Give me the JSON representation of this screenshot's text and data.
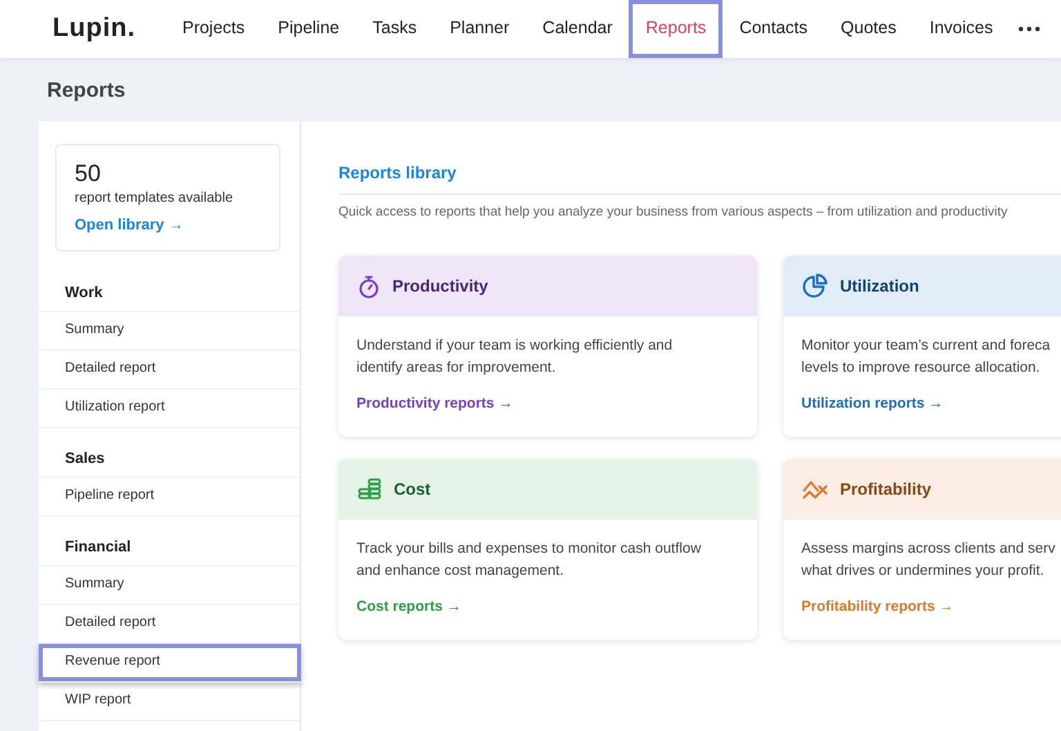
{
  "logo": "Lupin.",
  "nav": [
    {
      "label": "Projects",
      "selected": false,
      "highlighted": false
    },
    {
      "label": "Pipeline",
      "selected": false,
      "highlighted": false
    },
    {
      "label": "Tasks",
      "selected": false,
      "highlighted": false
    },
    {
      "label": "Planner",
      "selected": false,
      "highlighted": false
    },
    {
      "label": "Calendar",
      "selected": false,
      "highlighted": false
    },
    {
      "label": "Reports",
      "selected": true,
      "highlighted": true
    },
    {
      "label": "Contacts",
      "selected": false,
      "highlighted": false
    },
    {
      "label": "Quotes",
      "selected": false,
      "highlighted": false
    },
    {
      "label": "Invoices",
      "selected": false,
      "highlighted": false
    }
  ],
  "page_title": "Reports",
  "templates_card": {
    "count": "50",
    "caption": "report templates available",
    "link": "Open library →"
  },
  "sidebar": [
    {
      "heading": "Work",
      "items": [
        {
          "label": "Summary",
          "highlighted": false
        },
        {
          "label": "Detailed report",
          "highlighted": false
        },
        {
          "label": "Utilization report",
          "highlighted": false
        }
      ]
    },
    {
      "heading": "Sales",
      "items": [
        {
          "label": "Pipeline report",
          "highlighted": false
        }
      ]
    },
    {
      "heading": "Financial",
      "items": [
        {
          "label": "Summary",
          "highlighted": false
        },
        {
          "label": "Detailed report",
          "highlighted": false
        },
        {
          "label": "Revenue report",
          "highlighted": true
        },
        {
          "label": "WIP report",
          "highlighted": false
        }
      ]
    }
  ],
  "library": {
    "title": "Reports library",
    "subtitle": "Quick access to reports that help you analyze your business from various aspects – from utilization and productivity"
  },
  "cards": [
    {
      "kind": "stopwatch",
      "color": "#7b3fc4",
      "title": "Productivity",
      "description_lines": [
        "Understand if your team is working efficiently and",
        "identify areas for improvement."
      ],
      "link": "Productivity reports →"
    },
    {
      "kind": "pie",
      "color": "#1a6fc0",
      "title": "Utilization",
      "description_lines": [
        "Monitor your team’s current and foreca",
        "levels to improve resource allocation."
      ],
      "link": "Utilization reports →"
    },
    {
      "kind": "coins",
      "color": "#2f9e44",
      "title": "Cost",
      "description_lines": [
        "Track your bills and expenses to monitor cash outflow",
        "and enhance cost management."
      ],
      "link": "Cost reports →"
    },
    {
      "kind": "trend",
      "color": "#e0772a",
      "title": "Profitability",
      "description_lines": [
        "Assess margins across clients and serv",
        "what drives or undermines your profit."
      ],
      "link": "Profitability reports →"
    }
  ]
}
